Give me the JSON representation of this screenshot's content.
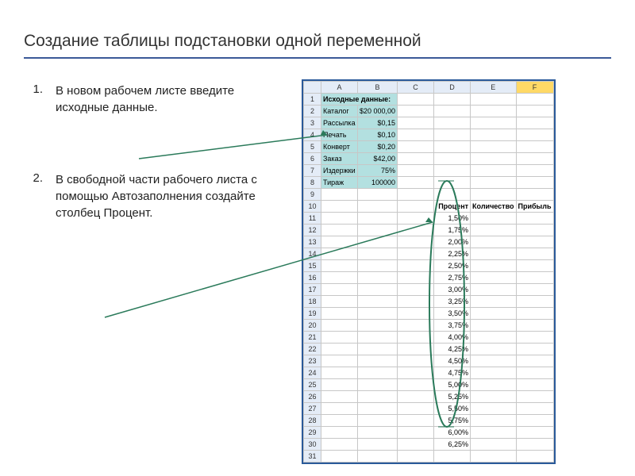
{
  "title": "Создание таблицы подстановки одной переменной",
  "instructions": [
    {
      "num": "1.",
      "text": "В новом рабочем листе введите исходные данные."
    },
    {
      "num": "2.",
      "text": "В свободной части рабочего листа с помощью Автозаполнения создайте столбец Процент."
    }
  ],
  "sheet": {
    "columns": [
      "A",
      "B",
      "C",
      "D",
      "E",
      "F"
    ],
    "selected_col": "F",
    "source_block": {
      "header": "Исходные данные:",
      "rows": [
        {
          "label": "Каталог",
          "value": "$20 000,00"
        },
        {
          "label": "Рассылка",
          "value": "$0,15"
        },
        {
          "label": "Печать",
          "value": "$0,10"
        },
        {
          "label": "Конверт",
          "value": "$0,20"
        },
        {
          "label": "Заказ",
          "value": "$42,00"
        },
        {
          "label": "Издержки",
          "value": "75%"
        },
        {
          "label": "Тираж",
          "value": "100000"
        }
      ]
    },
    "data_table": {
      "headers": [
        "Процент",
        "Количество",
        "Прибыль"
      ],
      "percents": [
        "1,50%",
        "1,75%",
        "2,00%",
        "2,25%",
        "2,50%",
        "2,75%",
        "3,00%",
        "3,25%",
        "3,50%",
        "3,75%",
        "4,00%",
        "4,25%",
        "4,50%",
        "4,75%",
        "5,00%",
        "5,25%",
        "5,50%",
        "5,75%",
        "6,00%",
        "6,25%"
      ]
    }
  }
}
